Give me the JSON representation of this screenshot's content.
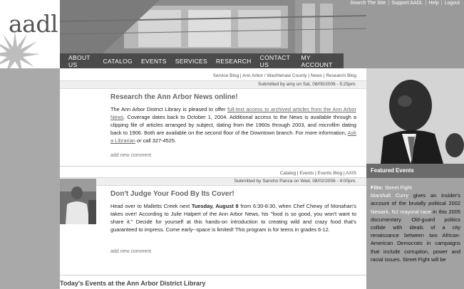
{
  "logo": {
    "text": "aadl.org"
  },
  "top_links": [
    "Search The Site",
    "Support AADL",
    "Help",
    "Logout"
  ],
  "nav": [
    "ABOUT US",
    "CATALOG",
    "EVENTS",
    "SERVICES",
    "RESEARCH",
    "CONTACT US",
    "MY ACCOUNT"
  ],
  "posts": [
    {
      "blog_links": "Service Blog | Ann Arbor / Washtenaw County | News | Research Blog",
      "submitted": "Submitted by amy on Sat, 08/05/2006 - 5:25pm.",
      "title": "Research the Ann Arbor News online!",
      "body_pre": "The Ann Arbor District Library is pleased to offer ",
      "body_link": "full-text access to archived articles from the Ann Arbor News",
      "body_mid": ". Coverage dates back to October 1, 2004. Additional access to the News is available through a clipping file of articles arranged by subject, dating from the 1960s through 2003, and microfilm dating back to 1906. Both are available on the second floor of the Downtown branch. For more information, ",
      "body_link2": "Ask a Librarian",
      "body_post": " or call 327-4525.",
      "add_comment": "add new comment"
    },
    {
      "blog_links": "Catalog | Events | Events Blog | AXIS",
      "submitted": "Submitted by Sancho Panza on Wed, 08/02/2006 - 4:00pm.",
      "title": "Don't Judge Your Food By Its Cover!",
      "body_pre": "Head over to Malletts Creek next ",
      "body_bold": "Tuesday, August 8",
      "body_post": " from 6:30-8:30, when Chef Chewy of Monahan's takes over! According to Julie Halpert of the Ann Arbor News, his \"food is so good, you won't want to share it.\" Decide for yourself at this hands-on introduction to creating wild and crazy food that's guaranteed to impress. Come early--space is limited! This program is for teens in grades 6-12.",
      "add_comment": "add new comment"
    }
  ],
  "today_heading": "Today's Events at the Ann Arbor District Library",
  "sidebar": {
    "featured_heading": "Featured Events",
    "film_label": "Film:",
    "film_title": "Street Fight",
    "person_link": "Marshall Curry",
    "text_a": " gives an insider's account of the brutally political 2002 ",
    "place_link": "Newark, NJ mayoral race",
    "text_b": " in this 2005 documentary. Old-guard politics collide with ideals of a city renaissance between two African-American Democrats in campaigns that include corruption, power and racial issues. Street Fight will be"
  },
  "colors": {
    "nav_bg": "#4a4a4a",
    "gutter": "#a9a9a9",
    "featured_bg": "#6b6b6b"
  }
}
